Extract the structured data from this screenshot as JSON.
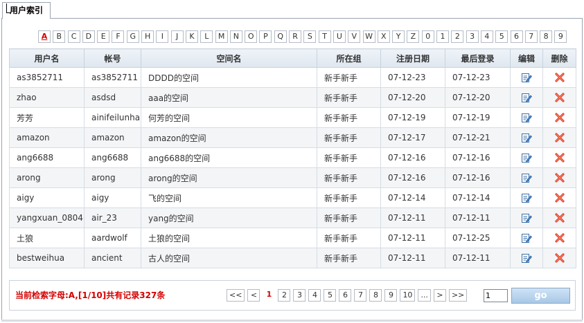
{
  "tab": {
    "label": "用户索引"
  },
  "alphabet": {
    "active": "A",
    "letters": [
      "A",
      "B",
      "C",
      "D",
      "E",
      "F",
      "G",
      "H",
      "I",
      "J",
      "K",
      "L",
      "M",
      "N",
      "O",
      "P",
      "Q",
      "R",
      "S",
      "T",
      "U",
      "V",
      "W",
      "X",
      "Y",
      "Z",
      "0",
      "1",
      "2",
      "3",
      "4",
      "5",
      "6",
      "7",
      "8",
      "9"
    ]
  },
  "table": {
    "headers": {
      "username": "用户名",
      "account": "帐号",
      "space": "空间名",
      "group": "所在组",
      "register_date": "注册日期",
      "last_login": "最后登录",
      "edit": "编辑",
      "delete": "删除"
    },
    "rows": [
      {
        "username": "as3852711",
        "account": "as3852711",
        "space": "DDDD的空间",
        "group": "新手新手",
        "register_date": "07-12-23",
        "last_login": "07-12-23"
      },
      {
        "username": "zhao",
        "account": "asdsd",
        "space": "aaa的空间",
        "group": "新手新手",
        "register_date": "07-12-20",
        "last_login": "07-12-20"
      },
      {
        "username": "芳芳",
        "account": "ainifeilunhai",
        "space": "何芳的空间",
        "group": "新手新手",
        "register_date": "07-12-19",
        "last_login": "07-12-19"
      },
      {
        "username": "amazon",
        "account": "amazon",
        "space": "amazon的空间",
        "group": "新手新手",
        "register_date": "07-12-17",
        "last_login": "07-12-21"
      },
      {
        "username": "ang6688",
        "account": "ang6688",
        "space": "ang6688的空间",
        "group": "新手新手",
        "register_date": "07-12-16",
        "last_login": "07-12-16"
      },
      {
        "username": "arong",
        "account": "arong",
        "space": "arong的空间",
        "group": "新手新手",
        "register_date": "07-12-16",
        "last_login": "07-12-16"
      },
      {
        "username": "aigy",
        "account": "aigy",
        "space": "飞的空间",
        "group": "新手新手",
        "register_date": "07-12-14",
        "last_login": "07-12-14"
      },
      {
        "username": "yangxuan_0804",
        "account": "air_23",
        "space": "yang的空间",
        "group": "新手新手",
        "register_date": "07-12-11",
        "last_login": "07-12-11"
      },
      {
        "username": "土狼",
        "account": "aardwolf",
        "space": "土狼的空间",
        "group": "新手新手",
        "register_date": "07-12-11",
        "last_login": "07-12-25"
      },
      {
        "username": "bestweihua",
        "account": "ancient",
        "space": "古人的空间",
        "group": "新手新手",
        "register_date": "07-12-11",
        "last_login": "07-12-11"
      }
    ]
  },
  "footer": {
    "status": "当前检索字母:A,[1/10]共有记录327条",
    "pager": {
      "first": "<<",
      "prev": "<",
      "current": "1",
      "pages": [
        "2",
        "3",
        "4",
        "5",
        "6",
        "7",
        "8",
        "9",
        "10"
      ],
      "ellipsis": "...",
      "next": ">",
      "last": ">>"
    },
    "page_input_value": "1",
    "go_label": "go"
  },
  "colors": {
    "accent_red": "#d40000",
    "header_bg": "#dfe7ef",
    "go_button": "#a8c8e6",
    "border": "#9aa4ae"
  },
  "icons": {
    "edit": "edit-document-icon",
    "delete": "delete-x-icon"
  }
}
